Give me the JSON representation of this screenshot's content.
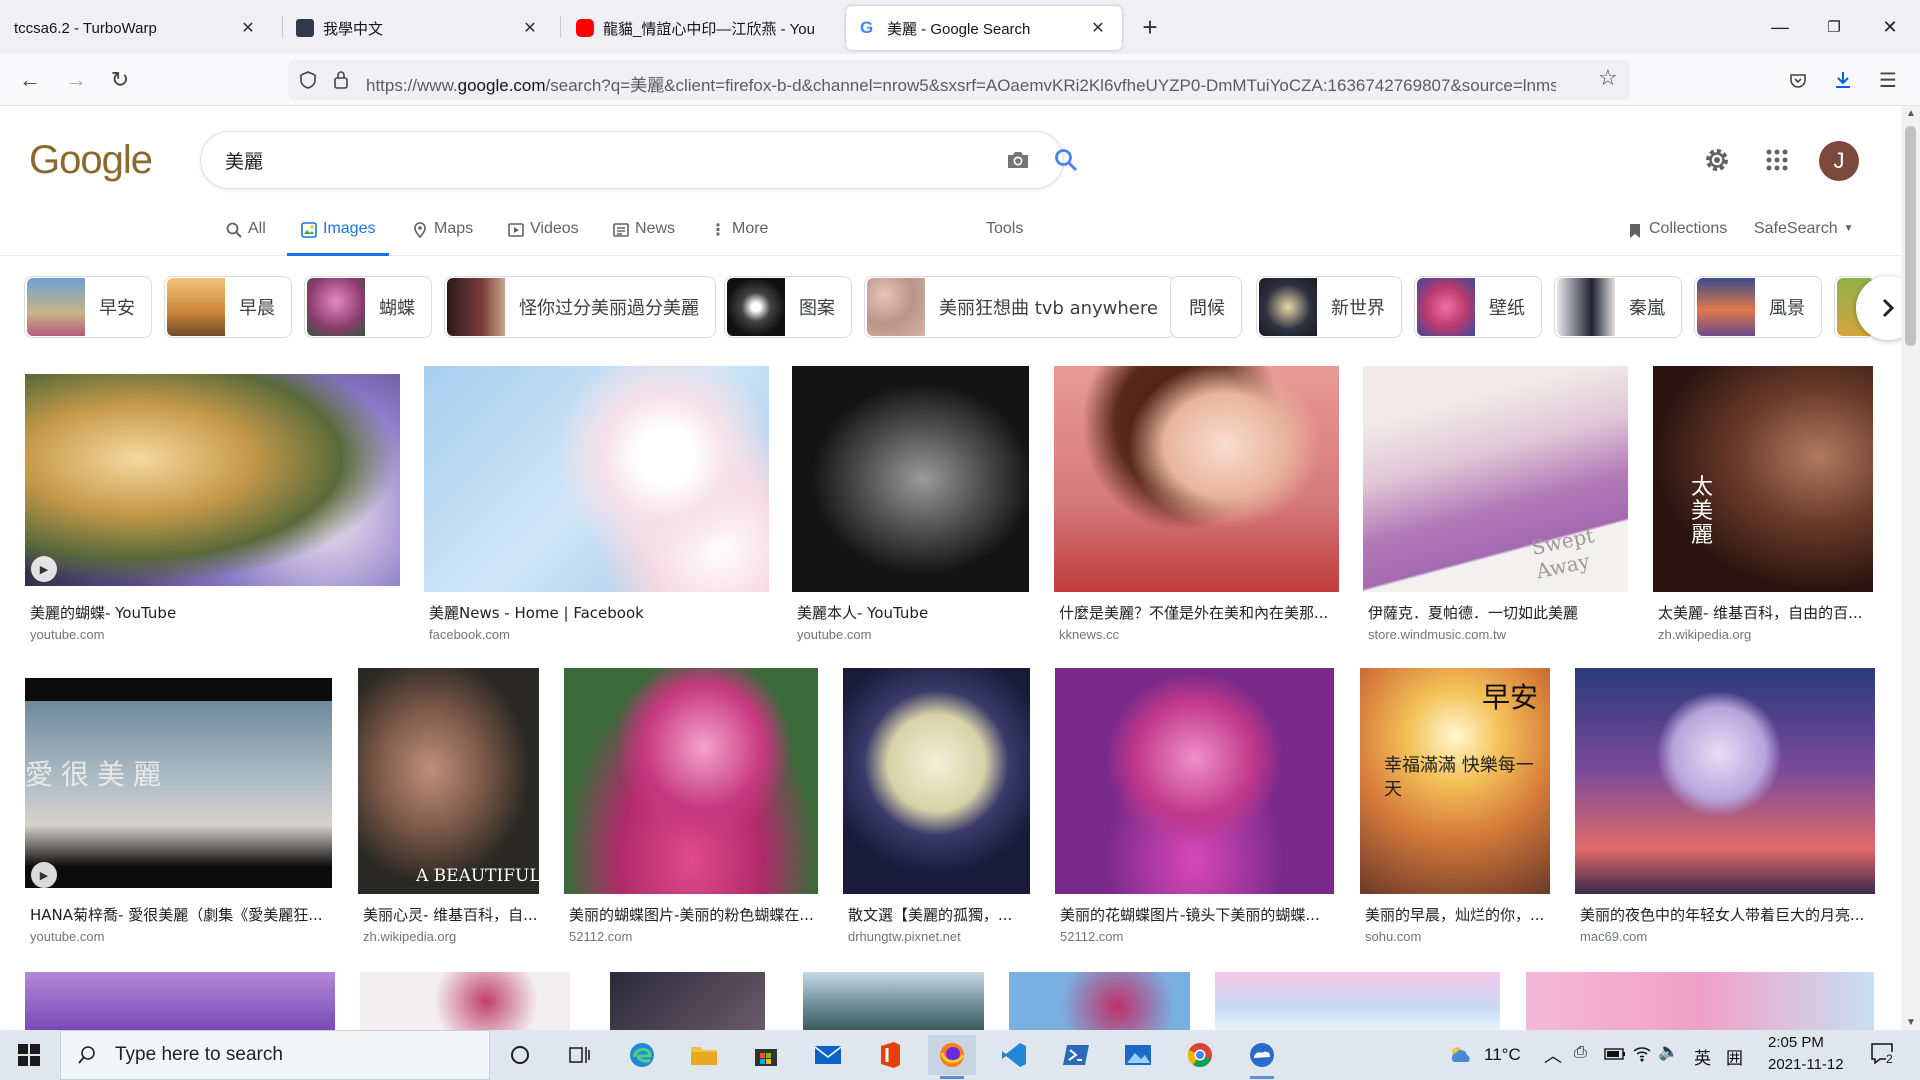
{
  "browser": {
    "tabs": [
      {
        "title": "tccsa6.2 - TurboWarp",
        "active": false
      },
      {
        "title": "我學中文",
        "active": false
      },
      {
        "title": "龍貓_情誼心中印—江欣燕 - You",
        "active": false
      },
      {
        "title": "美麗 - Google Search",
        "active": true
      }
    ],
    "url_prefix": "https://www.",
    "url_host": "google.com",
    "url_rest": "/search?q=美麗&client=firefox-b-d&channel=nrow5&sxsrf=AOaemvKRi2Kl6vfheUYZP0-DmMTuiYoCZA:1636742769807&source=lnms&"
  },
  "google": {
    "logo": "Google",
    "query": "美麗",
    "tabs": [
      "All",
      "Images",
      "Maps",
      "Videos",
      "News",
      "More"
    ],
    "tools": "Tools",
    "collections": "Collections",
    "safesearch": "SafeSearch",
    "avatar_letter": "J"
  },
  "chips": [
    "早安",
    "早晨",
    "蝴蝶",
    "怪你过分美丽過分美麗",
    "图案",
    "美丽狂想曲 tvb anywhere",
    "問候",
    "新世界",
    "壁纸",
    "秦嵐",
    "風景"
  ],
  "results": [
    {
      "caption": "美麗的蝴蝶- YouTube",
      "source": "youtube.com"
    },
    {
      "caption": "美麗News - Home | Facebook",
      "source": "facebook.com"
    },
    {
      "caption": "美麗本人- YouTube",
      "source": "youtube.com"
    },
    {
      "caption": "什麼是美麗？不僅是外在美和內在美那...",
      "source": "kknews.cc"
    },
    {
      "caption": "伊薩克．夏帕德．一切如此美麗",
      "source": "store.windmusic.com.tw"
    },
    {
      "caption": "太美麗- 维基百科，自由的百...",
      "source": "zh.wikipedia.org"
    },
    {
      "caption": "HANA菊梓喬- 愛很美麗（劇集《愛美麗狂...",
      "source": "youtube.com"
    },
    {
      "caption": "美丽心灵- 维基百科，自...",
      "source": "zh.wikipedia.org"
    },
    {
      "caption": "美丽的蝴蝶图片-美丽的粉色蝴蝶在...",
      "source": "52112.com"
    },
    {
      "caption": "散文選【美麗的孤獨，...",
      "source": "drhungtw.pixnet.net"
    },
    {
      "caption": "美丽的花蝴蝶图片-镜头下美丽的蝴蝶...",
      "source": "52112.com"
    },
    {
      "caption": "美丽的早晨，灿烂的你，...",
      "source": "sohu.com"
    },
    {
      "caption": "美丽的夜色中的年轻女人带着巨大的月亮...",
      "source": "mac69.com"
    }
  ],
  "image_text": {
    "r6": "太美麗",
    "r7": "愛很美麗",
    "r8": "A BEAUTIFUL",
    "r12a": "早安",
    "r12b": "幸福滿滿 快樂每一天",
    "r5": "Swept Away"
  },
  "taskbar": {
    "search_placeholder": "Type here to search",
    "temperature": "11°C",
    "ime": "英",
    "time": "2:05 PM",
    "date": "2021-11-12",
    "notification_count": "2"
  }
}
